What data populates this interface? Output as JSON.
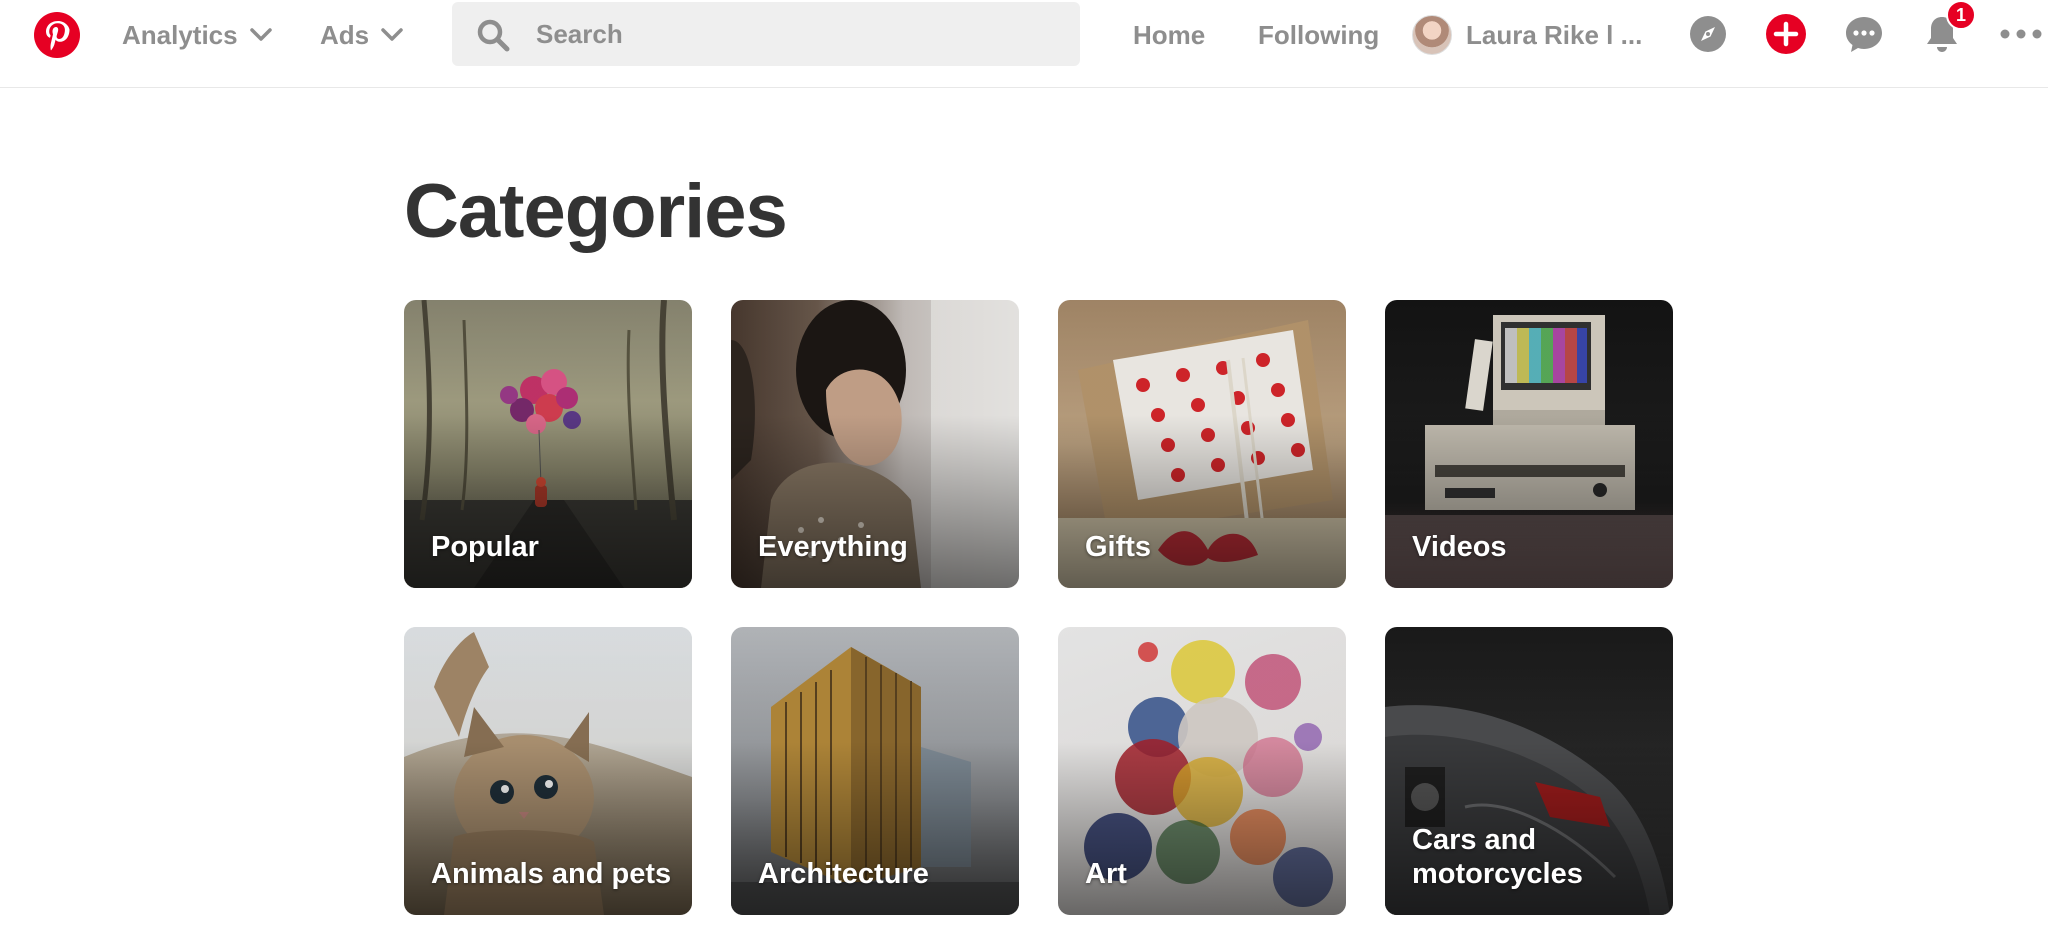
{
  "header": {
    "analytics_label": "Analytics",
    "ads_label": "Ads",
    "search_placeholder": "Search",
    "home_label": "Home",
    "following_label": "Following",
    "profile_name": "Laura Rike l ...",
    "notification_count": "1",
    "brand_color": "#e60023"
  },
  "page": {
    "title": "Categories"
  },
  "categories": [
    {
      "label": "Popular"
    },
    {
      "label": "Everything"
    },
    {
      "label": "Gifts"
    },
    {
      "label": "Videos"
    },
    {
      "label": "Animals and pets"
    },
    {
      "label": "Architecture"
    },
    {
      "label": "Art"
    },
    {
      "label": "Cars and motorcycles"
    }
  ]
}
